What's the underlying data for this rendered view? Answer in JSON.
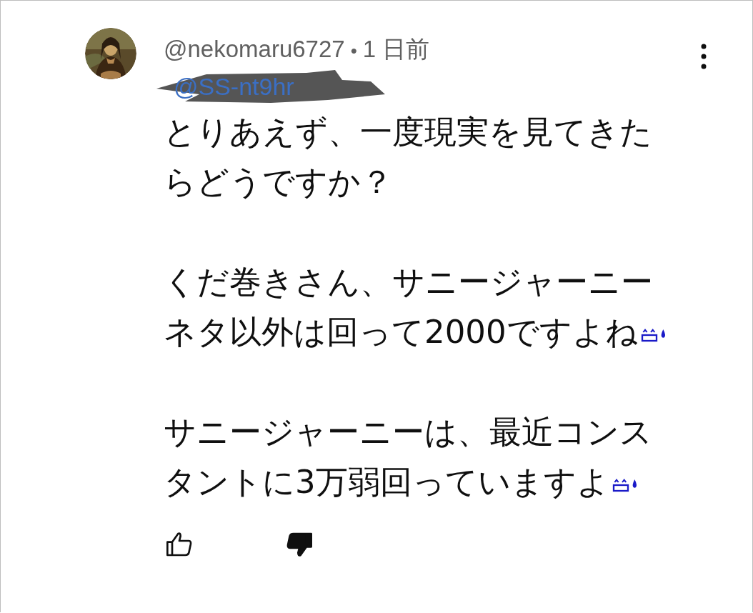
{
  "comment": {
    "author": "@nekomaru6727",
    "separator": "•",
    "time": "1 日前",
    "mention": "@SS-nt9hr",
    "mention_redacted": true,
    "paragraphs": [
      {
        "text": "とりあえず、一度現実を見てきたらどうですか？",
        "emoji": false
      },
      {
        "text": "くだ巻きさん、サニージャーニーネタ以外は回って2000ですよね",
        "emoji": true
      },
      {
        "text": "サニージャーニーは、最近コンスタントに3万弱回っていますよ",
        "emoji": true
      }
    ],
    "like": {
      "selected": false
    },
    "dislike": {
      "selected": true
    }
  }
}
